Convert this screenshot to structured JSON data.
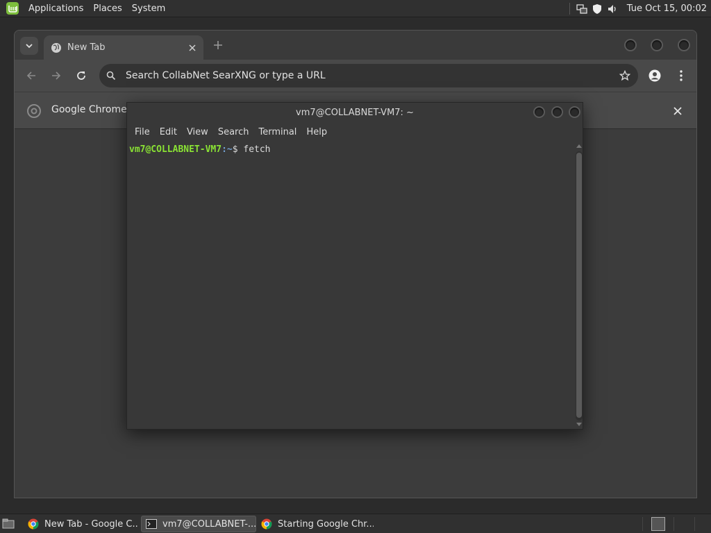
{
  "top_panel": {
    "menus": [
      "Applications",
      "Places",
      "System"
    ],
    "clock": "Tue Oct 15, 00:02"
  },
  "chrome": {
    "tab_title": "New Tab",
    "omnibox_placeholder": "Search CollabNet SearXNG or type a URL",
    "infobar_text": "Google Chrome is"
  },
  "terminal": {
    "title": "vm7@COLLABNET-VM7: ~",
    "menus": [
      "File",
      "Edit",
      "View",
      "Search",
      "Terminal",
      "Help"
    ],
    "prompt_user": "vm7@COLLABNET-VM7",
    "prompt_path": ":~",
    "prompt_symbol": "$ ",
    "command": "fetch"
  },
  "taskbar": {
    "tasks": [
      {
        "label": "New Tab - Google C...",
        "icon": "chrome-icon",
        "active": false
      },
      {
        "label": "vm7@COLLABNET-...",
        "icon": "terminal-icon",
        "active": true
      },
      {
        "label": "Starting Google Chr...",
        "icon": "chrome-icon",
        "active": false
      }
    ]
  },
  "colors": {
    "prompt_user": "#8ae234",
    "prompt_path": "#729fcf",
    "mint_green": "#7dbe3d"
  }
}
